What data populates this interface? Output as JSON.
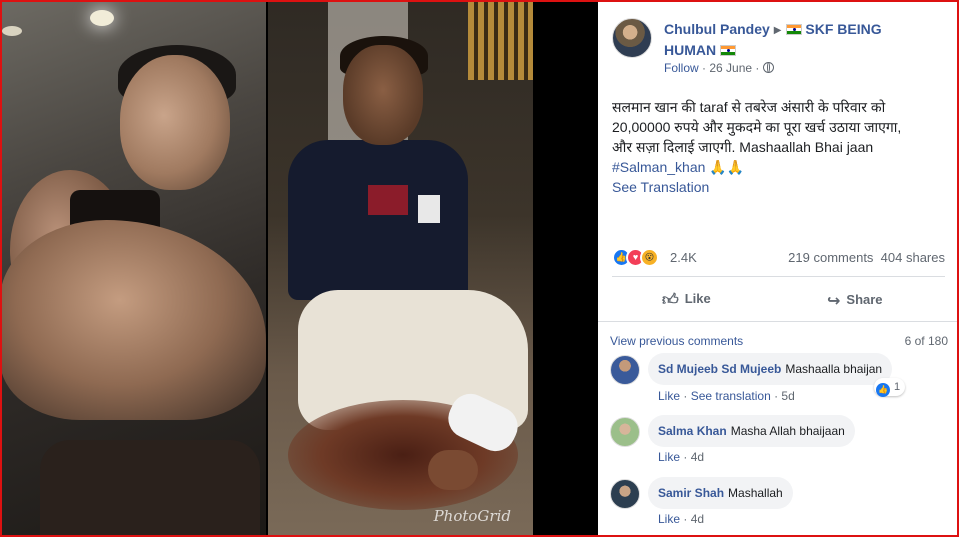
{
  "photo": {
    "watermark": "PhotoGrid"
  },
  "post": {
    "author": "Chulbul Pandey",
    "page_name": "🇮🇳 SKF BEING HUMAN 🇮🇳",
    "page_name_prefix": "SKF BEING",
    "page_name_suffix": "HUMAN",
    "follow_label": "Follow",
    "date": "26 June",
    "text_line1": "सलमान खान की taraf से तबरेज अंसारी के परिवार को",
    "text_line2": "20,00000 रुपये और मुकदमे का पूरा खर्च उठाया जाएगा,",
    "text_line3": "और सज़ा दिलाई जाएगी. Mashaallah Bhai jaan",
    "hashtag": "#Salman_khan",
    "folded_hands": "🙏🙏",
    "see_translation": "See Translation"
  },
  "reactions": {
    "count": "2.4K",
    "comments": "219 comments",
    "shares": "404 shares"
  },
  "actions": {
    "like_label": "Like",
    "share_label": "Share"
  },
  "comments_section": {
    "view_previous": "View previous comments",
    "count": "6 of 180",
    "items": [
      {
        "name": "Sd Mujeeb Sd Mujeeb",
        "text": "Mashaalla bhaijan",
        "like": "Like",
        "see_translation": "See translation",
        "time": "5d",
        "reaction_count": "1"
      },
      {
        "name": "Salma Khan",
        "text": "Masha Allah bhaijaan",
        "like": "Like",
        "time": "4d"
      },
      {
        "name": "Samir Shah",
        "text": "Mashallah",
        "like": "Like",
        "time": "4d"
      }
    ]
  },
  "icons": {
    "arrow": "right-triangle-icon",
    "globe": "globe-icon",
    "like": "thumbs-up-icon",
    "share": "share-arrow-icon",
    "reaction_like": "like-reaction-icon",
    "reaction_love": "love-reaction-icon",
    "reaction_wow": "wow-reaction-icon"
  },
  "colors": {
    "link": "#385898",
    "border": "#dd1111",
    "like_blue": "#1877f2",
    "love_red": "#f33e58",
    "wow_yellow": "#f7b125"
  }
}
